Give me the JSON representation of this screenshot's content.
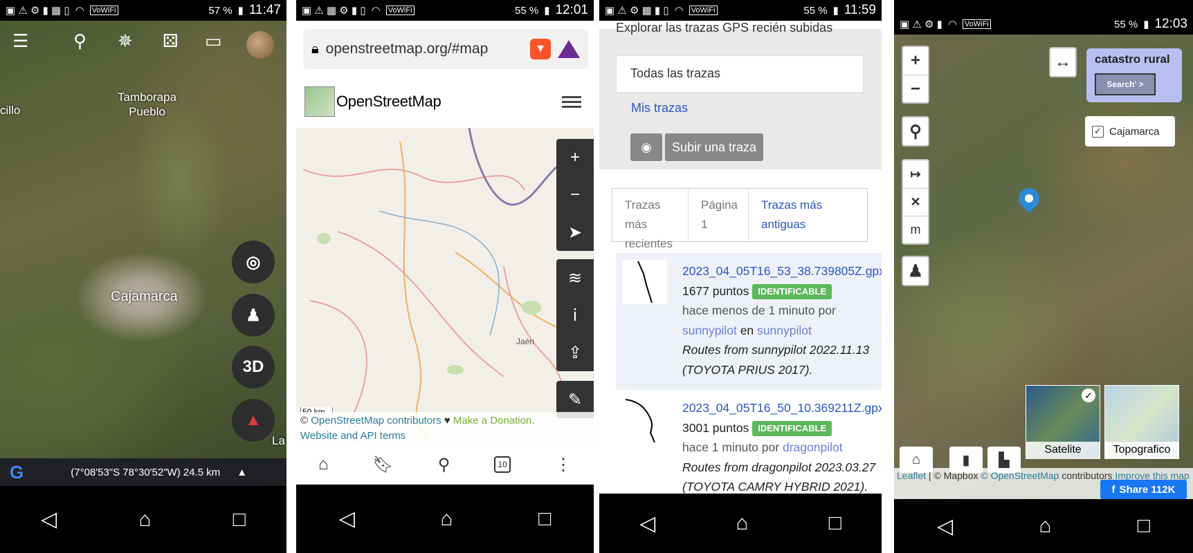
{
  "panel1": {
    "status": {
      "battery": "57 %",
      "time": "11:47",
      "volte": "VoWiFi"
    },
    "labels": {
      "town1": "Tamborapa\nPueblo",
      "town2": "cillo",
      "city": "Cajamarca",
      "edge": "La"
    },
    "btn3d": "3D",
    "coords": "(7°08'53\"S 78°30'52\"W) 24.5 km",
    "google": "G"
  },
  "panel2": {
    "status": {
      "battery": "55 %",
      "time": "12:01",
      "volte": "VoWiFi"
    },
    "url": "openstreetmap.org/#map",
    "site_name": "OpenStreetMap",
    "map_label": "Jaén",
    "scale": "50 km",
    "attribution": {
      "osm": "OpenStreetMap contributors",
      "heart": "♥",
      "donate": "Make a Donation.",
      "terms": "Website and API terms",
      "copy": "©"
    },
    "tab_count": "10"
  },
  "panel3": {
    "status": {
      "battery": "55 %",
      "time": "11:59",
      "volte": "VoWiFi"
    },
    "header_cut": "Explorar las trazas GPS recién subidas",
    "select": "Todas las trazas",
    "my_traces": "Mis trazas",
    "upload": "Subir una traza",
    "pagination": {
      "newer": "Trazas más recientes",
      "page": "Página 1",
      "older": "Trazas más antiguas"
    },
    "traces": [
      {
        "name": "2023_04_05T16_53_38.739805Z.gpx",
        "points": "1677 puntos",
        "badge": "IDENTIFICABLE",
        "when": "hace menos de 1 minuto por",
        "user": "sunnypilot",
        "en": "en",
        "tag": "sunnypilot",
        "desc": "Routes from sunnypilot 2022.11.13 (TOYOTA PRIUS 2017)."
      },
      {
        "name": "2023_04_05T16_50_10.369211Z.gpx",
        "points": "3001 puntos",
        "badge": "IDENTIFICABLE",
        "when": "hace 1 minuto por",
        "user": "dragonpilot",
        "en": "",
        "tag": "",
        "desc": "Routes from dragonpilot 2023.03.27 (TOYOTA CAMRY HYBRID 2021)."
      }
    ]
  },
  "panel4": {
    "status": {
      "battery": "55 %",
      "time": "12:03",
      "volte": "VoWiFi"
    },
    "catastro_title": "catastro rural",
    "search_btn": "Search' >",
    "checkbox_label": "Cajamarca",
    "measure_m": "m",
    "tiles": [
      "Satelite",
      "Topografico"
    ],
    "attribution": {
      "leaflet": "Leaflet",
      "mapbox": "© Mapbox",
      "osm": "© OpenStreetMap",
      "contrib": "contributors",
      "improve": "Improve this map"
    },
    "fb_share": "Share 112K"
  }
}
